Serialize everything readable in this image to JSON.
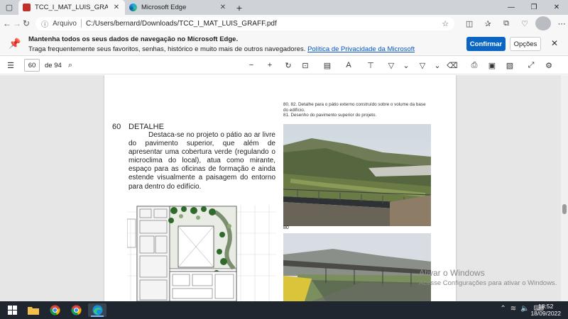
{
  "tabs": [
    {
      "label": "TCC_I_MAT_LUIS_GRAFF.pdf",
      "icon": "pdf-icon",
      "active": true
    },
    {
      "label": "Microsoft Edge",
      "icon": "edge-icon",
      "active": false
    }
  ],
  "address": {
    "scheme": "Arquivo",
    "url": "C:/Users/bernard/Downloads/TCC_I_MAT_LUIS_GRAFF.pdf"
  },
  "banner": {
    "title": "Mantenha todos os seus dados de navegação no Microsoft Edge.",
    "text": "Traga frequentemente seus favoritos, senhas, histórico e muito mais de outros navegadores.",
    "link": "Política de Privacidade da Microsoft",
    "confirm": "Confirmar",
    "options": "Opções"
  },
  "pdf_toolbar": {
    "page": "60",
    "total": "de 94"
  },
  "document": {
    "page_number": "60",
    "heading": "DETALHE",
    "body": "Destaca-se no projeto o pátio ao ar livre do pavimento superior, que além de apresentar uma cobertura verde (regulando o microclima do local), atua como mirante, espaço para as oficinas de formação e ainda estende visualmente a paisagem do entorno para dentro do edifício.",
    "caption_line1": "80, 82. Detalhe para o pátio externo construído sobre o volume da base do edifício.",
    "caption_line2": "81. Desenho do pavimento superior do projeto.",
    "photo_label": "80"
  },
  "watermark": {
    "line1": "Ativar o Windows",
    "line2": "Acesse Configurações para ativar o Windows."
  },
  "clock": {
    "time": "18:52",
    "date": "18/09/2022"
  },
  "colors": {
    "accent": "#0a66c2",
    "taskbar": "#1f2630",
    "tab_strip": "#cfd2d6"
  }
}
